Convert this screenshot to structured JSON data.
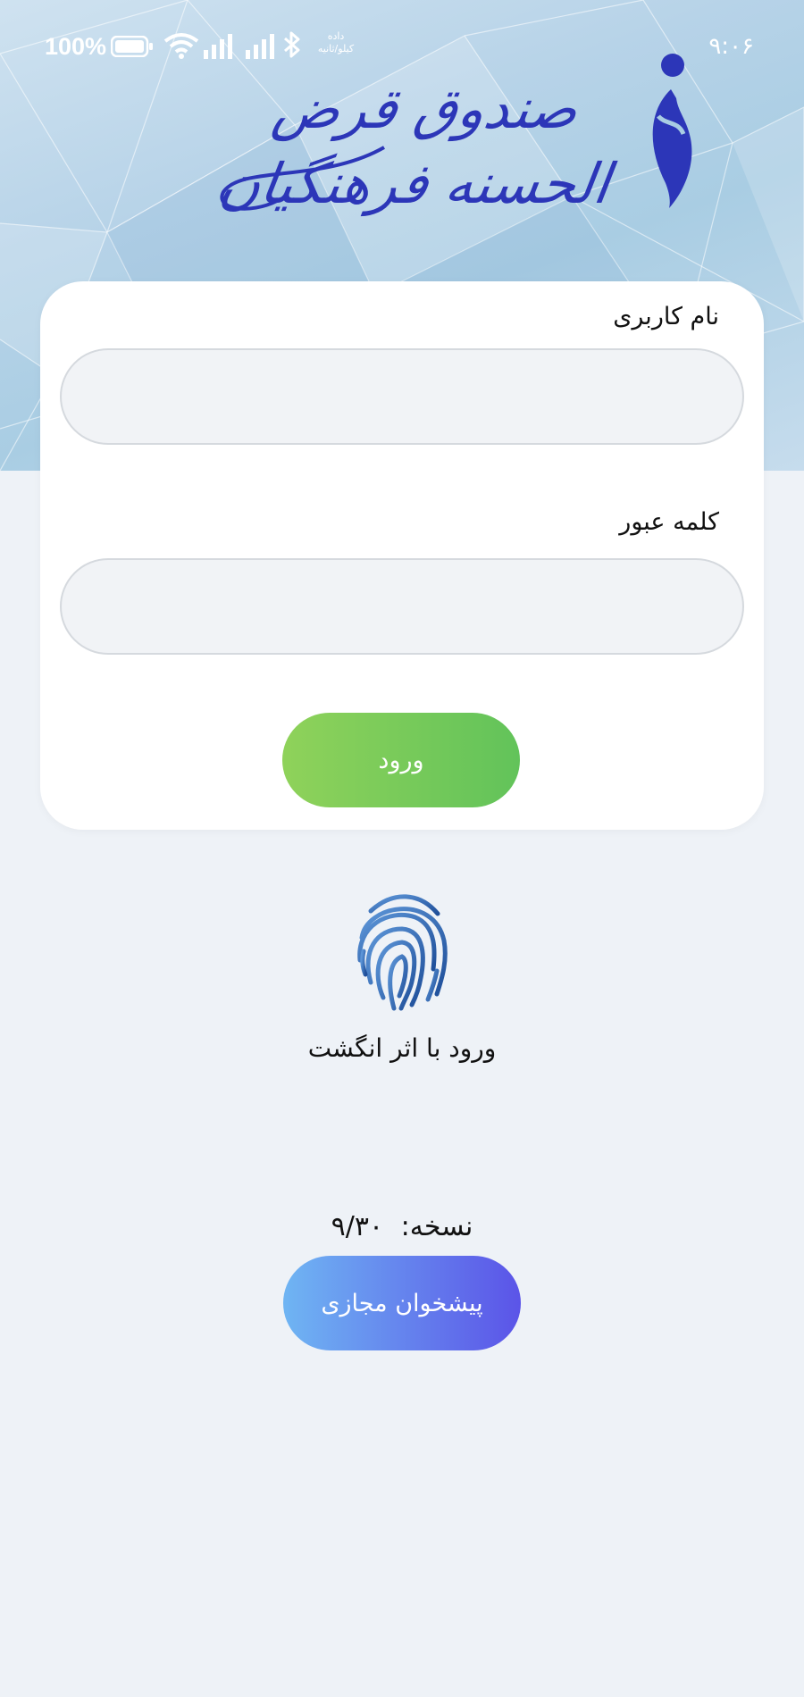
{
  "status_bar": {
    "battery_text": "100%",
    "data_label_line1": "داده",
    "data_label_line2": "کیلو/ثانیه",
    "time": "۹:۰۶",
    "icons": [
      "battery-icon",
      "wifi-icon",
      "signal-icon",
      "signal-icon",
      "bluetooth-icon"
    ]
  },
  "header": {
    "logo_text": "صندوق قرض الحسنه فرهنگیان",
    "logo_color": "#2c36b8"
  },
  "login": {
    "username_label": "نام کاربری",
    "username_value": "",
    "password_label": "کلمه عبور",
    "password_value": "",
    "submit_label": "ورود",
    "submit_color": "#76c95a"
  },
  "fingerprint": {
    "label": "ورود با اثر انگشت",
    "icon": "fingerprint-icon"
  },
  "footer": {
    "version_label": "نسخه:",
    "version_value": "۹/۳۰",
    "kiosk_label": "پیشخوان مجازی",
    "kiosk_gradient": [
      "#6fb5f3",
      "#5b54e8"
    ]
  }
}
